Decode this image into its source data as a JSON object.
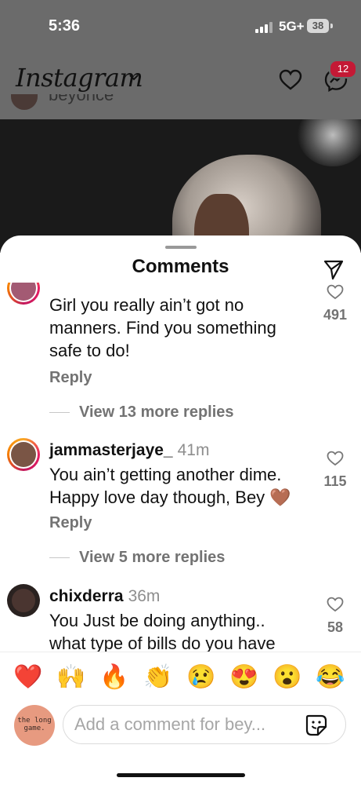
{
  "status_bar": {
    "time": "5:36",
    "network": "5G+",
    "battery": "38"
  },
  "header": {
    "logo": "Instagram",
    "notification_badge": "12"
  },
  "post": {
    "author_partial": "beyonce"
  },
  "sheet": {
    "title": "Comments"
  },
  "comments": [
    {
      "username": "",
      "time": "",
      "text": "Girl you really ain’t got no manners. Find you something safe to do!",
      "reply_label": "Reply",
      "view_replies": "View 13 more replies",
      "likes": "491"
    },
    {
      "username": "jammasterjaye_",
      "time": "41m",
      "text": "You ain’t getting another dime. Happy love day though, Bey 🤎",
      "reply_label": "Reply",
      "view_replies": "View 5 more replies",
      "likes": "115"
    },
    {
      "username": "chixderra",
      "time": "36m",
      "text": "You Just be doing anything.. what type of bills do you have",
      "likes": "58"
    }
  ],
  "quick_reactions": [
    "❤️",
    "🙌",
    "🔥",
    "👏",
    "😢",
    "😍",
    "😮",
    "😂"
  ],
  "composer": {
    "placeholder": "Add a comment for bey...",
    "my_avatar_text": "the long game."
  },
  "colors": {
    "accent_red": "#c41935",
    "muted_text": "#737373",
    "overlay": "#6b6b6b"
  }
}
